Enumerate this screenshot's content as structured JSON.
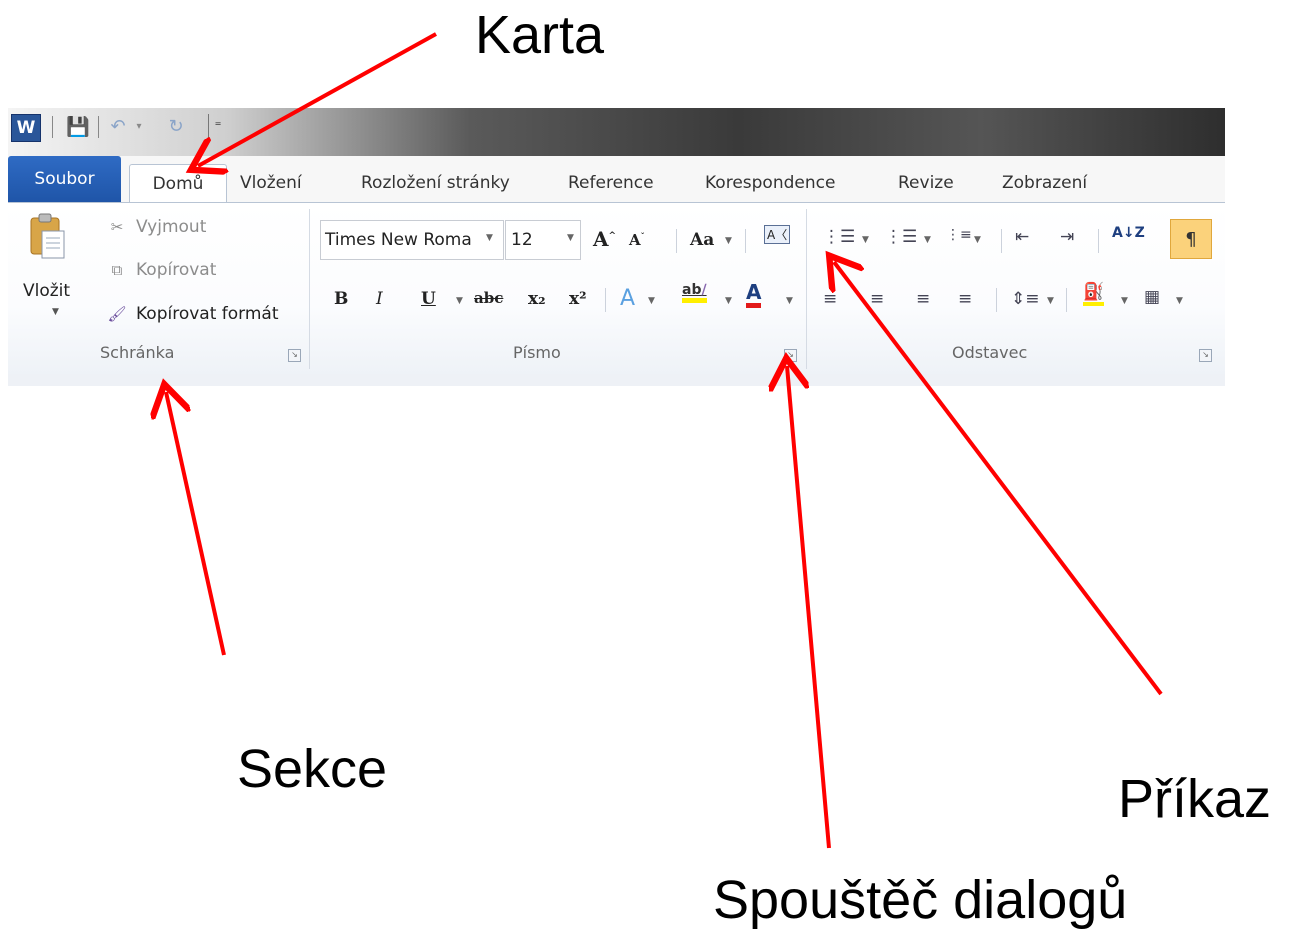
{
  "annotations": {
    "karta": "Karta",
    "sekce": "Sekce",
    "prikaz": "Příkaz",
    "spoustec": "Spouštěč dialogů",
    "arrow_color": "#ff0000"
  },
  "app": {
    "icon_letter": "W",
    "qat_customize": "⁼"
  },
  "tabs": [
    {
      "label": "Soubor"
    },
    {
      "label": "Domů",
      "active": true
    },
    {
      "label": "Vložení"
    },
    {
      "label": "Rozložení stránky"
    },
    {
      "label": "Reference"
    },
    {
      "label": "Korespondence"
    },
    {
      "label": "Revize"
    },
    {
      "label": "Zobrazení"
    }
  ],
  "clipboard": {
    "paste": "Vložit",
    "cut": "Vyjmout",
    "copy": "Kopírovat",
    "format_painter": "Kopírovat formát",
    "group_label": "Schránka"
  },
  "font": {
    "name": "Times New Roma",
    "size": "12",
    "group_label": "Písmo",
    "bold": "B",
    "italic": "I",
    "underline": "U",
    "strike": "abc",
    "subscript": "x₂",
    "superscript": "x²",
    "change_case": "Aa",
    "grow": "A",
    "shrink": "A",
    "highlight": "ab",
    "font_color": "A"
  },
  "paragraph": {
    "group_label": "Odstavec",
    "show_marks": "¶",
    "sort": "A↓Z"
  },
  "colors": {
    "file_tab": "#2a63b8",
    "highlight_yellow": "#ffef00",
    "font_color_red": "#e21a1a",
    "pilcrow_bg": "#fbd27b"
  }
}
